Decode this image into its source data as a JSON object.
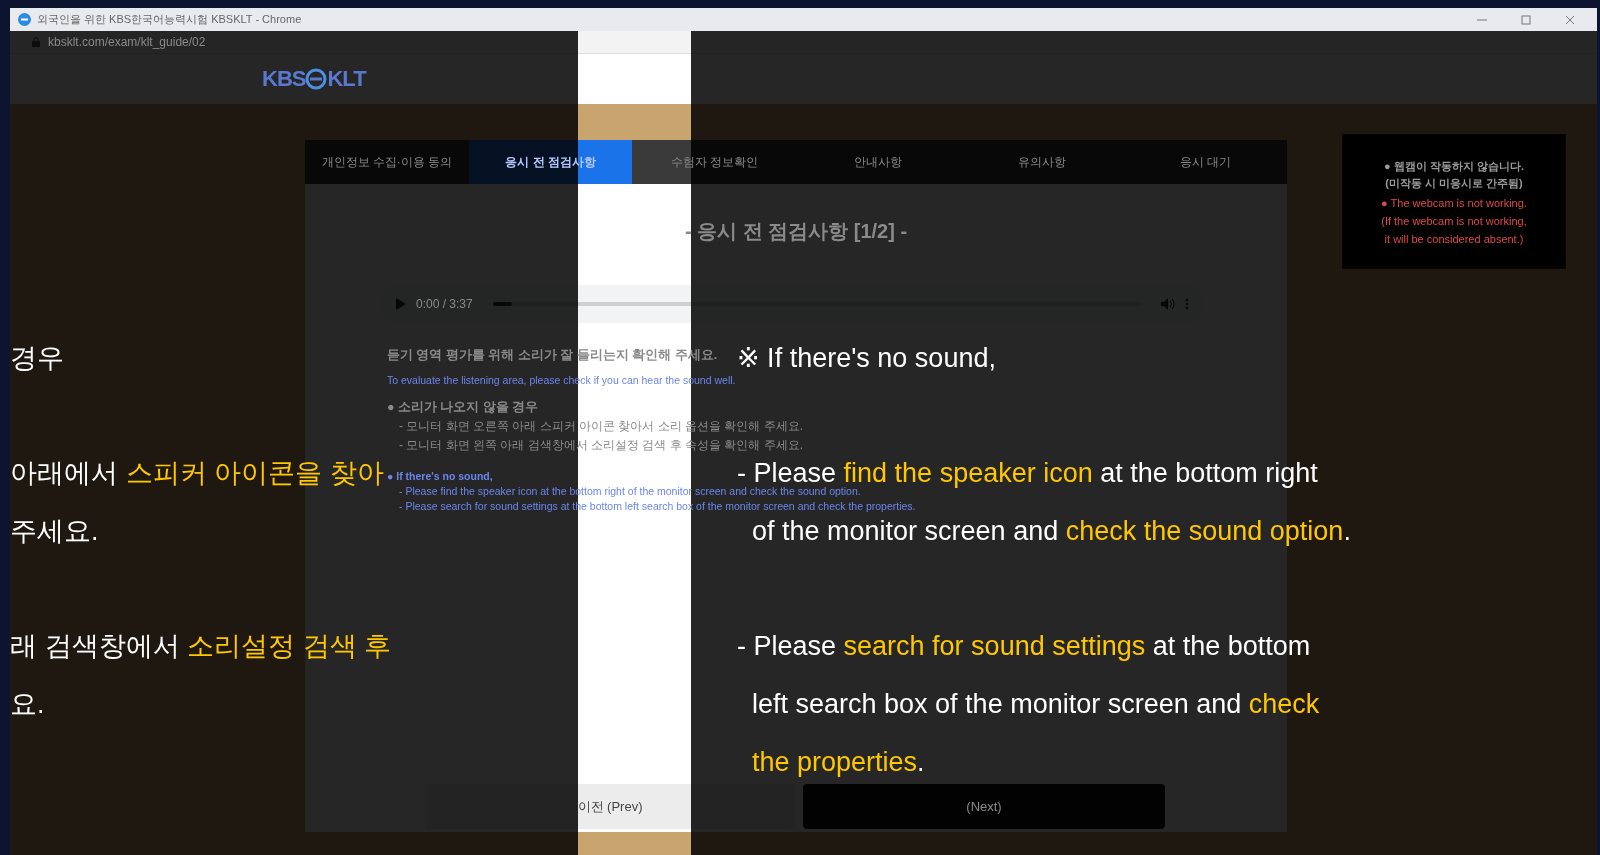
{
  "window": {
    "title": "외국인을 위한 KBS한국어능력시험 KBSKLT - Chrome"
  },
  "address_bar": {
    "url": "kbsklt.com/exam/klt_guide/02"
  },
  "logo": {
    "left": "KBS",
    "right": "KLT"
  },
  "tabs": [
    {
      "label": "개인정보 수집·이용 동의",
      "selected": false
    },
    {
      "label": "응시 전 점검사항",
      "selected": true
    },
    {
      "label": "수험자 정보확인",
      "selected": false
    },
    {
      "label": "안내사항",
      "selected": false
    },
    {
      "label": "유의사항",
      "selected": false
    },
    {
      "label": "응시 대기",
      "selected": false
    }
  ],
  "page_title": "- 응시 전 점검사항 [1/2] -",
  "audio_player": {
    "time": "0:00 / 3:37",
    "level": 0.03
  },
  "instructions": [
    {
      "kind": "lead",
      "text": "듣기 영역 평가를 위해 소리가 잘 들리는지 확인해 주세요."
    },
    {
      "kind": "lead_en",
      "text": "To evaluate the listening area, please check if you can hear the sound well."
    },
    {
      "kind": "bullet",
      "text": "● 소리가 나오지 않을 경우"
    },
    {
      "kind": "item",
      "text": "- 모니터 화면 오른쪽 아래 스피커 아이콘 찾아서 소리 옵션을 확인해 주세요."
    },
    {
      "kind": "item",
      "text": "- 모니터 화면 왼쪽 아래 검색창에서 소리설정 검색 후 속성을 확인해 주세요."
    },
    {
      "kind": "bullet_en",
      "text": "● If there's no sound,"
    },
    {
      "kind": "item_en",
      "text": "- Please find the speaker icon at the bottom right of the monitor screen and check the sound option."
    },
    {
      "kind": "item_en",
      "text": "- Please search for sound settings at the bottom left search box of the monitor screen and check the properties."
    }
  ],
  "buttons": [
    {
      "kind": "prev",
      "label": "이전 (Prev)"
    },
    {
      "kind": "next",
      "label": "(Next)"
    }
  ],
  "webcam_notice": [
    {
      "kind": "ko",
      "text": "● 웹캠이 작동하지 않습니다."
    },
    {
      "kind": "ko",
      "text": "(미작동 시 미응시로 간주됨)"
    },
    {
      "kind": "en",
      "text": "● The webcam is not working."
    },
    {
      "kind": "en",
      "text": "(If the webcam is not working,"
    },
    {
      "kind": "en",
      "text": "it will be considered absent.)"
    }
  ],
  "guide_overlay": {
    "left_paragraphs": [
      [
        [
          {
            "text": "경우",
            "highlight": false
          }
        ]
      ],
      [
        [
          {
            "text": "아래에서 ",
            "highlight": false
          },
          {
            "text": "스피커 아이콘을 찾아",
            "highlight": true
          }
        ],
        [
          {
            "text": "주세요.",
            "highlight": false
          }
        ]
      ],
      [
        [
          {
            "text": "래 검색창에서 ",
            "highlight": false
          },
          {
            "text": "소리설정 검색 후",
            "highlight": true
          }
        ],
        [
          {
            "text": "요.",
            "highlight": false
          }
        ]
      ]
    ],
    "right_paragraphs": [
      [
        [
          {
            "text": "※ If there's no sound,",
            "highlight": false
          }
        ]
      ],
      [
        [
          {
            "text": "- Please ",
            "highlight": false
          },
          {
            "text": "find the speaker icon",
            "highlight": true
          },
          {
            "text": " at the bottom right",
            "highlight": false
          }
        ],
        [
          {
            "text": "  of the monitor screen and ",
            "highlight": false
          },
          {
            "text": "check the sound option",
            "highlight": true
          },
          {
            "text": ".",
            "highlight": false
          }
        ]
      ],
      [
        [
          {
            "text": "- Please ",
            "highlight": false
          },
          {
            "text": "search for sound settings",
            "highlight": true
          },
          {
            "text": " at the bottom",
            "highlight": false
          }
        ],
        [
          {
            "text": "  left search box of the monitor screen and ",
            "highlight": false
          },
          {
            "text": "check",
            "highlight": true
          }
        ],
        [
          {
            "text": "  the properties",
            "highlight": true
          },
          {
            "text": ".",
            "highlight": false
          }
        ]
      ]
    ]
  }
}
